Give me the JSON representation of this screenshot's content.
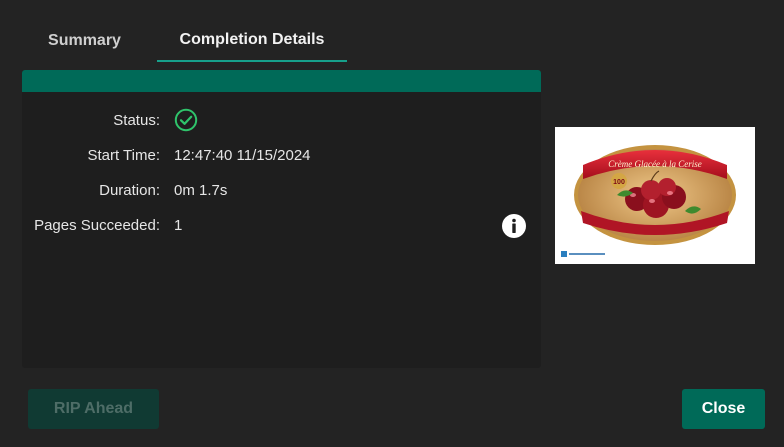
{
  "tabs": {
    "summary": "Summary",
    "details": "Completion Details"
  },
  "details": {
    "status_label": "Status:",
    "status_icon": "check-circle-icon",
    "start_time_label": "Start Time:",
    "start_time_value": "12:47:40 11/15/2024",
    "duration_label": "Duration:",
    "duration_value": "0m 1.7s",
    "pages_label": "Pages Succeeded:",
    "pages_value": "1"
  },
  "thumbnail": {
    "title": "Crème Glacée à la Cerise",
    "badge": "100"
  },
  "buttons": {
    "rip_ahead": "RIP Ahead",
    "close": "Close"
  },
  "colors": {
    "accent": "#006a58",
    "success": "#2fc46b",
    "background": "#232323",
    "panel": "#1e1e1e"
  }
}
